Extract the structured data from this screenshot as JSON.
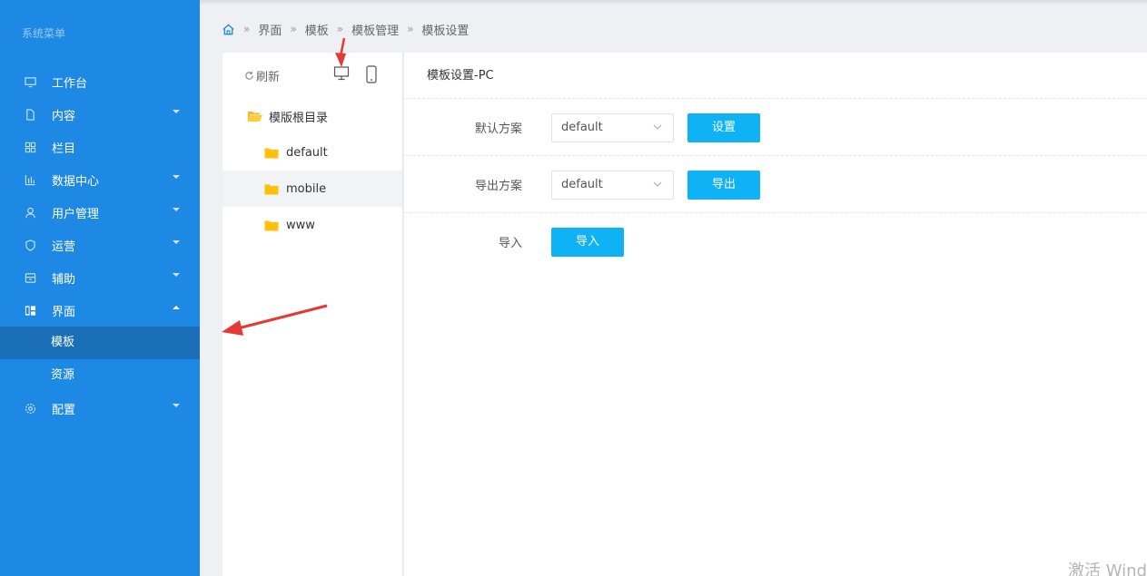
{
  "sidebar": {
    "title": "系统菜单",
    "items": [
      {
        "label": "工作台"
      },
      {
        "label": "内容"
      },
      {
        "label": "栏目"
      },
      {
        "label": "数据中心"
      },
      {
        "label": "用户管理"
      },
      {
        "label": "运营"
      },
      {
        "label": "辅助"
      },
      {
        "label": "界面"
      },
      {
        "label": "配置"
      }
    ],
    "sub_items": [
      {
        "label": "模板"
      },
      {
        "label": "资源"
      }
    ]
  },
  "breadcrumb": [
    "界面",
    "模板",
    "模板管理",
    "模板设置"
  ],
  "tree": {
    "refresh_label": "刷新",
    "root_label": "模版根目录",
    "nodes": [
      {
        "label": "default"
      },
      {
        "label": "mobile"
      },
      {
        "label": "www"
      }
    ]
  },
  "main": {
    "title": "模板设置-PC",
    "rows": [
      {
        "label": "默认方案",
        "select_value": "default",
        "button": "设置"
      },
      {
        "label": "导出方案",
        "select_value": "default",
        "button": "导出"
      },
      {
        "label": "导入",
        "button": "导入"
      }
    ]
  },
  "watermark": "激活 Windows",
  "colors": {
    "sidebar_bg": "#1e88e5",
    "sidebar_active": "#1a6fb8",
    "button": "#0eb2f5",
    "annotation_arrow": "#e53935",
    "folder": "#ffc107"
  }
}
